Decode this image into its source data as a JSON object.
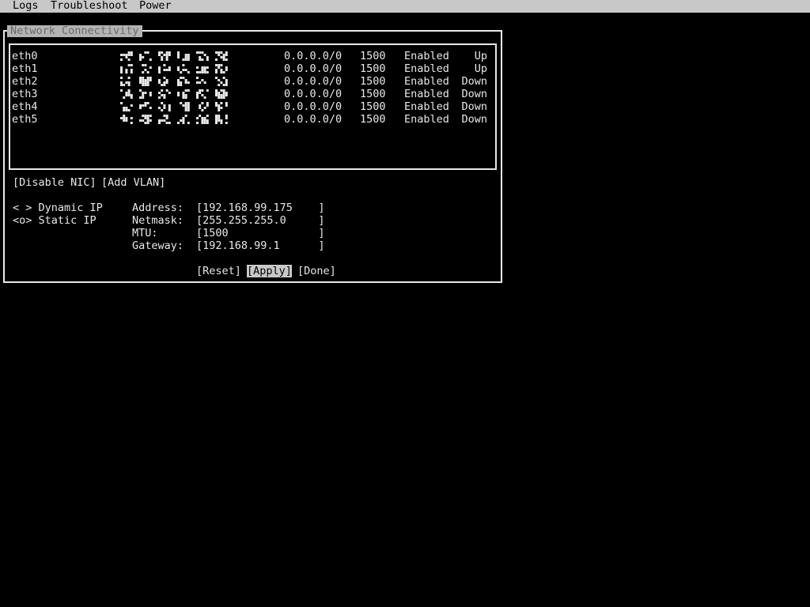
{
  "menu": {
    "items": [
      "Logs",
      "Troubleshoot",
      "Power"
    ]
  },
  "dialog": {
    "title": "Network Connectivity"
  },
  "nics": [
    {
      "name": "eth0",
      "mac_redacted": true,
      "address": "0.0.0.0/0",
      "mtu": "1500",
      "state": "Enabled",
      "link": "Up"
    },
    {
      "name": "eth1",
      "mac_redacted": true,
      "address": "0.0.0.0/0",
      "mtu": "1500",
      "state": "Enabled",
      "link": "Up"
    },
    {
      "name": "eth2",
      "mac_redacted": true,
      "address": "0.0.0.0/0",
      "mtu": "1500",
      "state": "Enabled",
      "link": "Down"
    },
    {
      "name": "eth3",
      "mac_redacted": true,
      "address": "0.0.0.0/0",
      "mtu": "1500",
      "state": "Enabled",
      "link": "Down"
    },
    {
      "name": "eth4",
      "mac_redacted": true,
      "address": "0.0.0.0/0",
      "mtu": "1500",
      "state": "Enabled",
      "link": "Down"
    },
    {
      "name": "eth5",
      "mac_redacted": true,
      "address": "0.0.0.0/0",
      "mtu": "1500",
      "state": "Enabled",
      "link": "Down"
    }
  ],
  "actions": {
    "disable_nic": "[Disable NIC]",
    "add_vlan": "[Add VLAN]"
  },
  "ip_mode": {
    "dynamic": "< > Dynamic IP",
    "static": "<o> Static IP"
  },
  "fields": {
    "address_label": "Address:",
    "address_value": "[192.168.99.175    ]",
    "netmask_label": "Netmask:",
    "netmask_value": "[255.255.255.0     ]",
    "mtu_label": "MTU:",
    "mtu_value": "[1500              ]",
    "gateway_label": "Gateway:",
    "gateway_value": "[192.168.99.1      ]"
  },
  "buttons": {
    "reset": "[Reset]",
    "apply": "[Apply]",
    "done": "[Done]"
  },
  "colors": {
    "background": "#000000",
    "foreground": "#e8e8e8",
    "menubar": "#c8c8c8",
    "title_bg": "#b4b4b4",
    "title_fg": "#6a6a6a"
  }
}
